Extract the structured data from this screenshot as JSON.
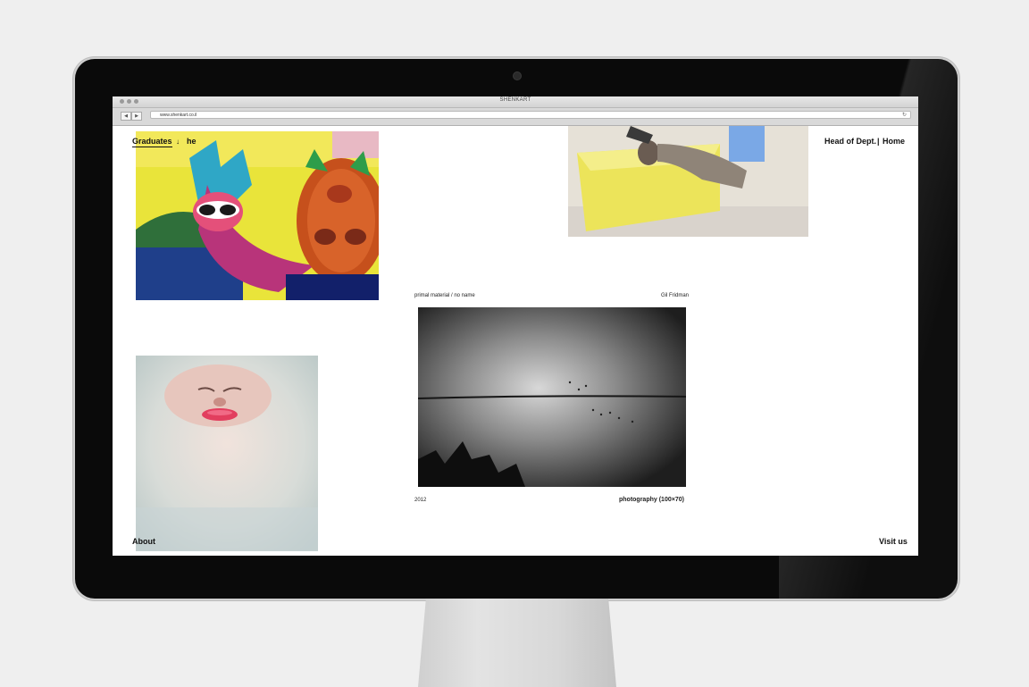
{
  "window": {
    "title": "SHENKART",
    "url": "www.shenkart.co.il",
    "back_symbol": "◀",
    "forward_symbol": "▶",
    "reload_symbol": "↻"
  },
  "nav": {
    "graduates": "Graduates",
    "arrow": "↓",
    "he": "he",
    "head_of_dept": "Head of Dept.",
    "separator": "|",
    "home": "Home",
    "about": "About",
    "visit_us": "Visit us"
  },
  "featured": {
    "title": "primal material / no name",
    "artist": "Gil Fridman",
    "year": "2012",
    "medium": "photography (100×70)"
  }
}
